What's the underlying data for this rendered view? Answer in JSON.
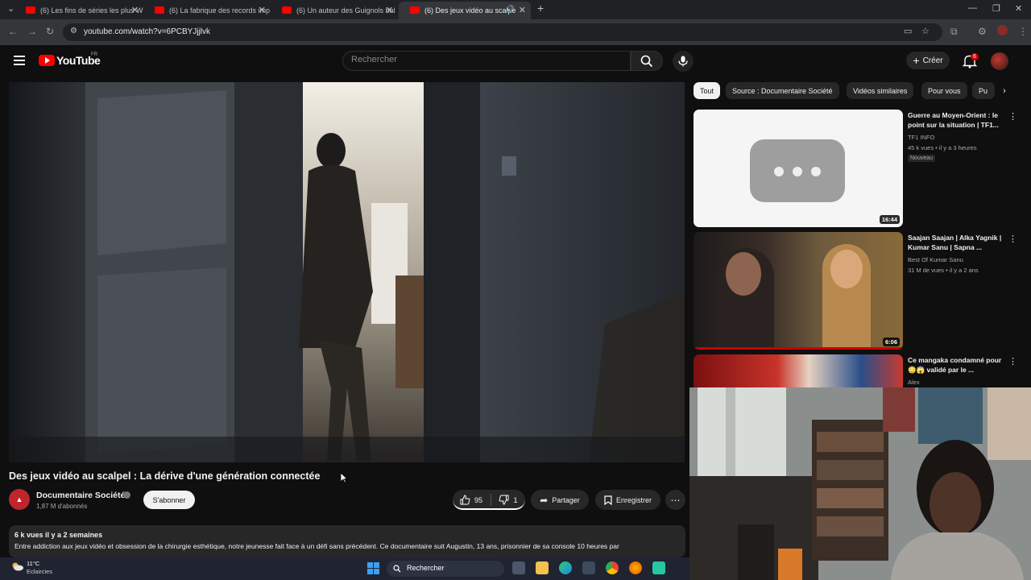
{
  "browser": {
    "tabs": [
      {
        "title": "(6) Les fins de séries les plus W"
      },
      {
        "title": "(6) La fabrique des records imp"
      },
      {
        "title": "(6) Un auteur des Guignols bal"
      },
      {
        "title": "(6) Des jeux vidéo au scalpe"
      }
    ],
    "url": "youtube.com/watch?v=6PCBYJjjlvk"
  },
  "youtube": {
    "logo_text": "YouTube",
    "region_code": "FR",
    "search_placeholder": "Rechercher",
    "create_label": "Créer",
    "notification_count": "6"
  },
  "video": {
    "title": "Des jeux vidéo au scalpel : La dérive d'une génération connectée",
    "channel": "Documentaire Société",
    "subscribers": "1,87 M d'abonnés",
    "subscribe_label": "S'abonner",
    "likes": "95",
    "dislikes": "1",
    "share_label": "Partager",
    "save_label": "Enregistrer",
    "views_date": "6 k vues  il y a 2 semaines",
    "description": "Entre addiction aux jeux vidéo et obsession de la chirurgie esthétique, notre jeunesse fait face à un défi sans précédent. Ce documentaire suit Augustin, 13 ans, prisonnier de sa console 10 heures par"
  },
  "chips": [
    "Tout",
    "Source : Documentaire Société",
    "Vidéos similaires",
    "Pour vous",
    "Pu"
  ],
  "recommendations": [
    {
      "title": "Guerre au Moyen-Orient : le point sur la situation | TF1...",
      "channel": "TF1 INFO",
      "meta": "45 k vues • il y a 3 heures",
      "badge": "Nouveau",
      "duration": "16:44"
    },
    {
      "title": "Saajan Saajan | Alka Yagnik | Kumar Sanu | Sapna ...",
      "channel": "Best Of Kumar Sanu",
      "meta": "31 M de vues • il y a 2 ans",
      "duration": "6:06"
    },
    {
      "title": "Ce mangaka condamné pour 😳😱 validé par le ...",
      "channel": "Alex"
    }
  ],
  "taskbar": {
    "temperature": "11°C",
    "condition": "Eclaircies",
    "search_label": "Rechercher"
  },
  "colors": {
    "youtube_red": "#ff0000",
    "background": "#0f0f0f",
    "chip_bg": "#272727"
  }
}
